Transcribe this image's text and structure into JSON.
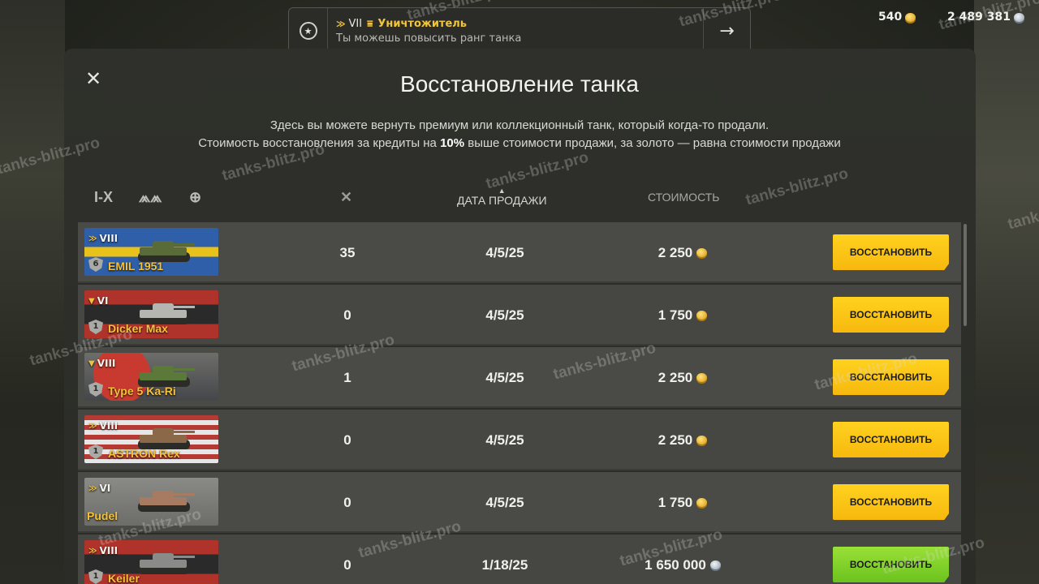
{
  "notification": {
    "tier": "VII",
    "rank_name": "Уничтожитель",
    "message": "Ты можешь повысить ранг танка"
  },
  "currency": {
    "gold": "540",
    "silver": "2 489 381"
  },
  "dialog": {
    "title": "Восстановление танка",
    "desc_line1": "Здесь вы можете вернуть премиум или коллекционный танк, который когда-то продали.",
    "desc_line2_a": "Стоимость восстановления за кредиты на ",
    "desc_line2_b": "10%",
    "desc_line2_c": " выше стоимости продажи, за золото — равна стоимости продажи"
  },
  "filters": {
    "tier_filter": "I-X"
  },
  "columns": {
    "date": "ДАТА ПРОДАЖИ",
    "cost": "СТОИМОСТЬ"
  },
  "rows": [
    {
      "tier": "VIII",
      "name": "EMIL 1951",
      "shield": "6",
      "kills": "35",
      "date": "4/5/25",
      "cost": "2 250",
      "currency": "gold",
      "button": "ВОССТАНОВИТЬ"
    },
    {
      "tier": "VI",
      "name": "Dicker Max",
      "shield": "1",
      "kills": "0",
      "date": "4/5/25",
      "cost": "1 750",
      "currency": "gold",
      "button": "ВОССТАНОВИТЬ"
    },
    {
      "tier": "VIII",
      "name": "Type 5 Ka-Ri",
      "shield": "1",
      "kills": "1",
      "date": "4/5/25",
      "cost": "2 250",
      "currency": "gold",
      "button": "ВОССТАНОВИТЬ"
    },
    {
      "tier": "VIII",
      "name": "ASTRON Rex",
      "shield": "1",
      "kills": "0",
      "date": "4/5/25",
      "cost": "2 250",
      "currency": "gold",
      "button": "ВОССТАНОВИТЬ"
    },
    {
      "tier": "VI",
      "name": "Pudel",
      "shield": "",
      "kills": "0",
      "date": "4/5/25",
      "cost": "1 750",
      "currency": "gold",
      "button": "ВОССТАНОВИТЬ"
    },
    {
      "tier": "VIII",
      "name": "Keiler",
      "shield": "1",
      "kills": "0",
      "date": "1/18/25",
      "cost": "1 650 000",
      "currency": "silver",
      "button": "ВОССТАНОВИТЬ"
    }
  ],
  "watermark": "tanks-blitz.pro"
}
